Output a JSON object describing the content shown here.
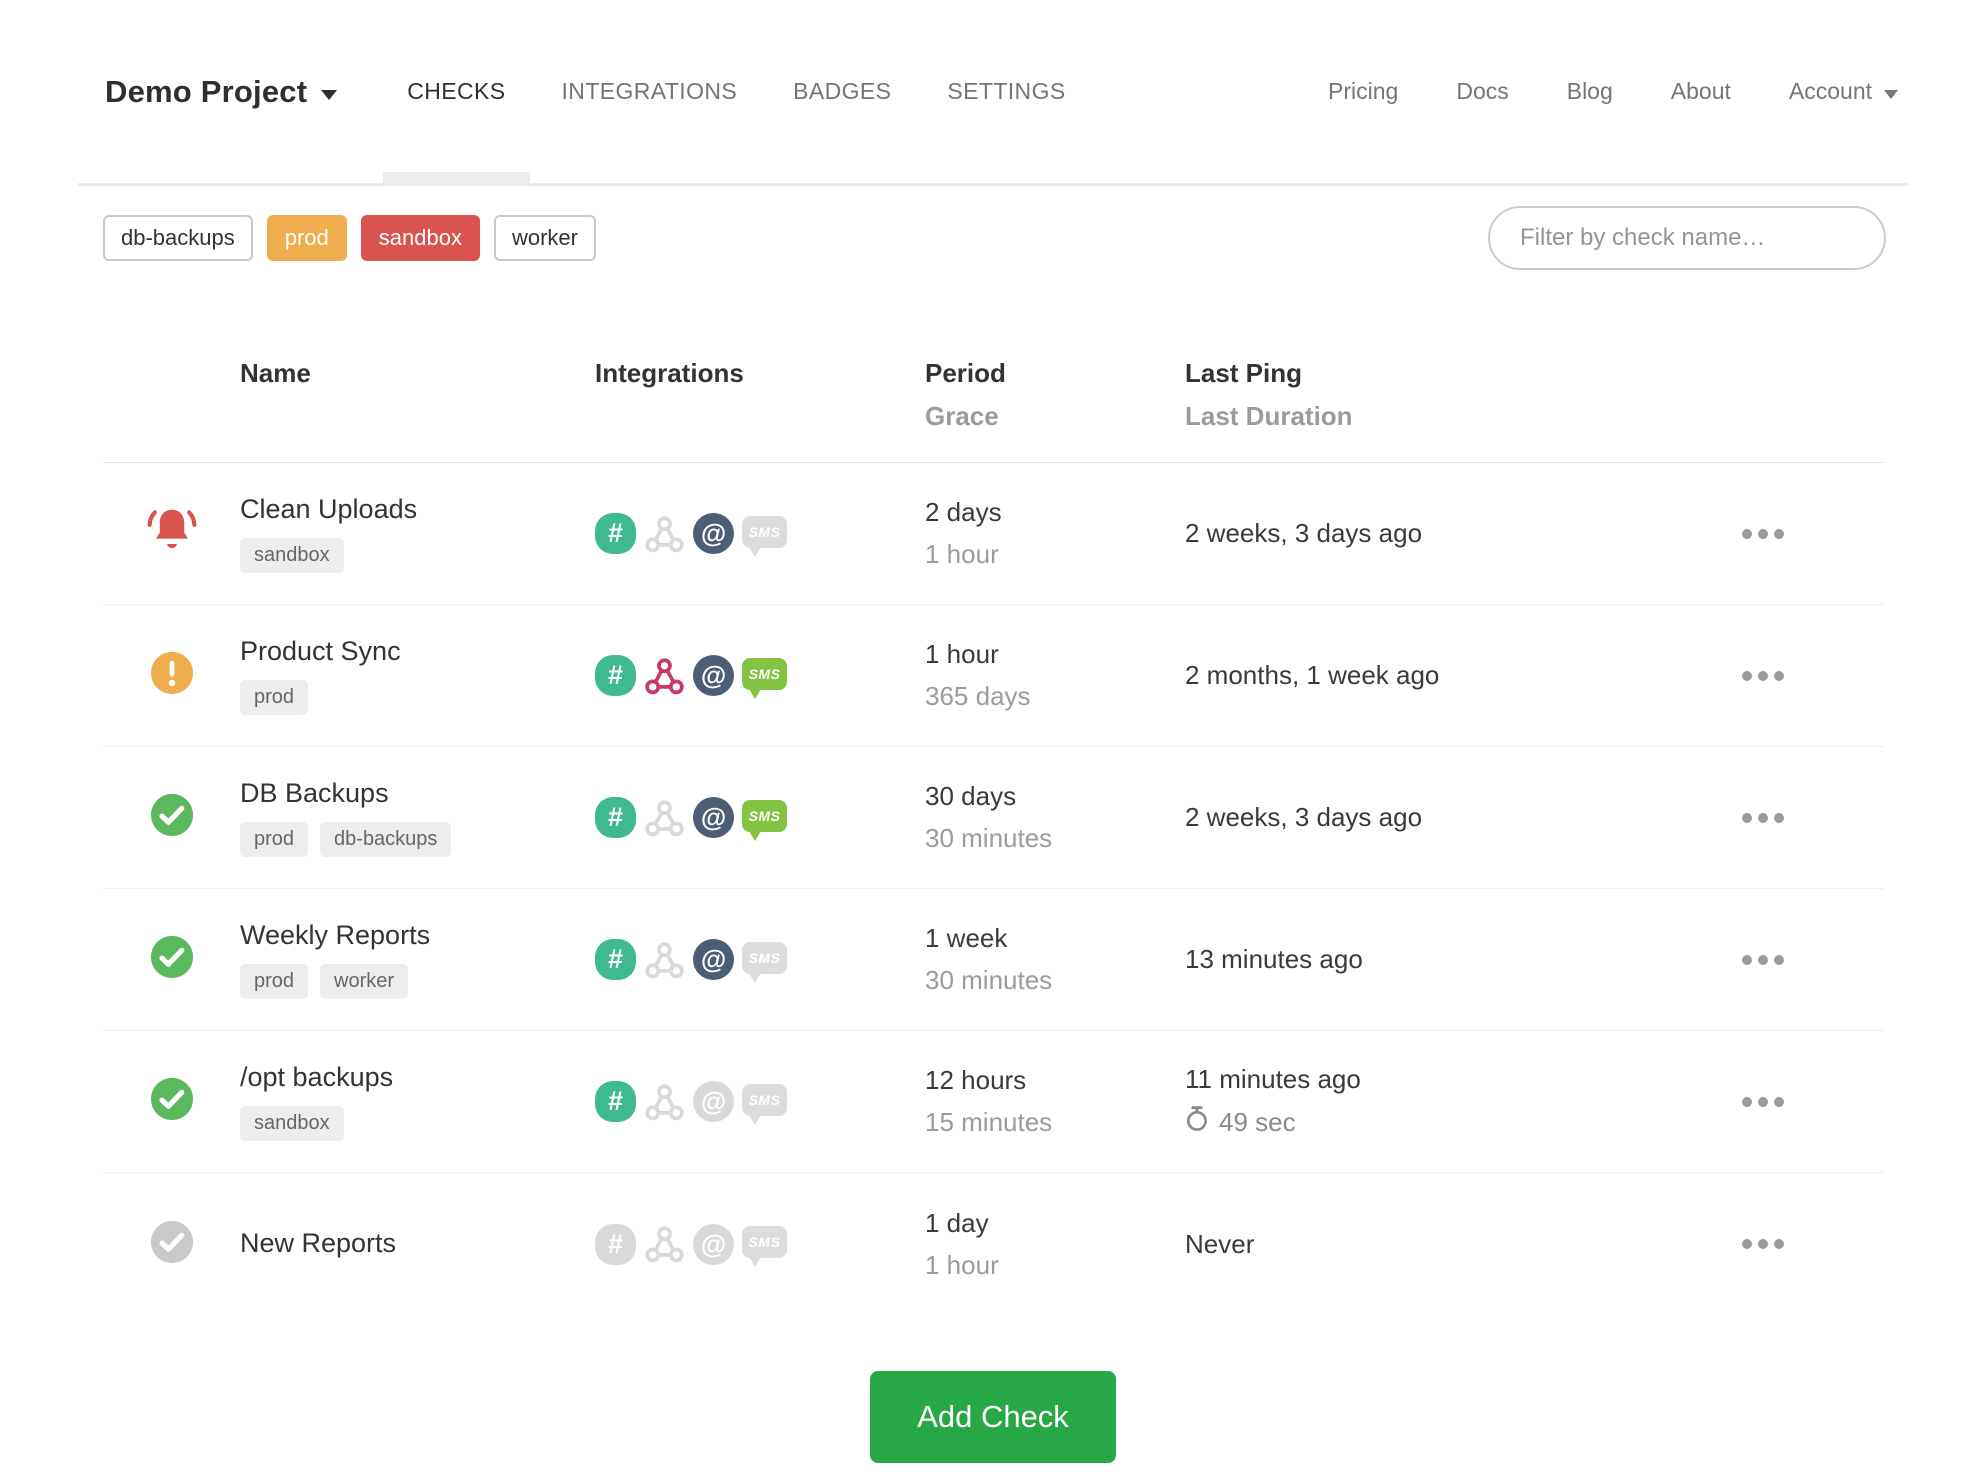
{
  "header": {
    "project": {
      "name": "Demo Project",
      "has_dropdown": true
    },
    "tabs": [
      {
        "label": "CHECKS",
        "active": true
      },
      {
        "label": "INTEGRATIONS",
        "active": false
      },
      {
        "label": "BADGES",
        "active": false
      },
      {
        "label": "SETTINGS",
        "active": false
      }
    ],
    "links": [
      {
        "label": "Pricing"
      },
      {
        "label": "Docs"
      },
      {
        "label": "Blog"
      },
      {
        "label": "About"
      },
      {
        "label": "Account",
        "has_dropdown": true
      }
    ]
  },
  "filters": {
    "tags": [
      {
        "label": "db-backups",
        "variant": "outline"
      },
      {
        "label": "prod",
        "variant": "orange"
      },
      {
        "label": "sandbox",
        "variant": "red"
      },
      {
        "label": "worker",
        "variant": "outline"
      }
    ],
    "search": {
      "placeholder": "Filter by check name…"
    }
  },
  "table": {
    "headers": {
      "name": "Name",
      "integrations": "Integrations",
      "period": "Period",
      "grace": "Grace",
      "last_ping": "Last Ping",
      "last_duration": "Last Duration"
    },
    "rows": [
      {
        "status": "alert",
        "name": "Clean Uploads",
        "tags": [
          "sandbox"
        ],
        "integrations": {
          "slack": true,
          "webhook": false,
          "email": true,
          "sms": false
        },
        "period": "2 days",
        "grace": "1 hour",
        "last_ping": "2 weeks, 3 days ago",
        "last_duration": ""
      },
      {
        "status": "warning",
        "name": "Product Sync",
        "tags": [
          "prod"
        ],
        "integrations": {
          "slack": true,
          "webhook": true,
          "email": true,
          "sms": true
        },
        "period": "1 hour",
        "grace": "365 days",
        "last_ping": "2 months, 1 week ago",
        "last_duration": ""
      },
      {
        "status": "up",
        "name": "DB Backups",
        "tags": [
          "prod",
          "db-backups"
        ],
        "integrations": {
          "slack": true,
          "webhook": false,
          "email": true,
          "sms": true
        },
        "period": "30 days",
        "grace": "30 minutes",
        "last_ping": "2 weeks, 3 days ago",
        "last_duration": ""
      },
      {
        "status": "up",
        "name": "Weekly Reports",
        "tags": [
          "prod",
          "worker"
        ],
        "integrations": {
          "slack": true,
          "webhook": false,
          "email": true,
          "sms": false
        },
        "period": "1 week",
        "grace": "30 minutes",
        "last_ping": "13 minutes ago",
        "last_duration": ""
      },
      {
        "status": "up",
        "name": "/opt backups",
        "tags": [
          "sandbox"
        ],
        "integrations": {
          "slack": true,
          "webhook": false,
          "email": false,
          "sms": false
        },
        "period": "12 hours",
        "grace": "15 minutes",
        "last_ping": "11 minutes ago",
        "last_duration": "49 sec"
      },
      {
        "status": "new",
        "name": "New Reports",
        "tags": [],
        "integrations": {
          "slack": false,
          "webhook": false,
          "email": false,
          "sms": false
        },
        "period": "1 day",
        "grace": "1 hour",
        "last_ping": "Never",
        "last_duration": ""
      }
    ]
  },
  "actions": {
    "add_check": "Add Check"
  },
  "icons": {
    "status_alert": "bell-icon",
    "status_warning": "exclamation-circle-icon",
    "status_up": "check-circle-icon",
    "status_new": "check-circle-icon",
    "integration_icons": [
      "slack-icon",
      "webhook-icon",
      "email-icon",
      "sms-icon"
    ],
    "duration": "stopwatch-icon",
    "row_menu": "ellipsis-icon"
  },
  "colors": {
    "alert_red": "#d9534f",
    "warning_orange": "#f0ad4e",
    "up_green": "#5cb85c",
    "new_gray": "#c9c9c9",
    "slack_green": "#3eb991",
    "webhook_pink": "#c73a63",
    "email_slate": "#4d5d73",
    "sms_green": "#82c341",
    "inactive_gray": "#d9d9d9",
    "add_check_green": "#28a745"
  }
}
